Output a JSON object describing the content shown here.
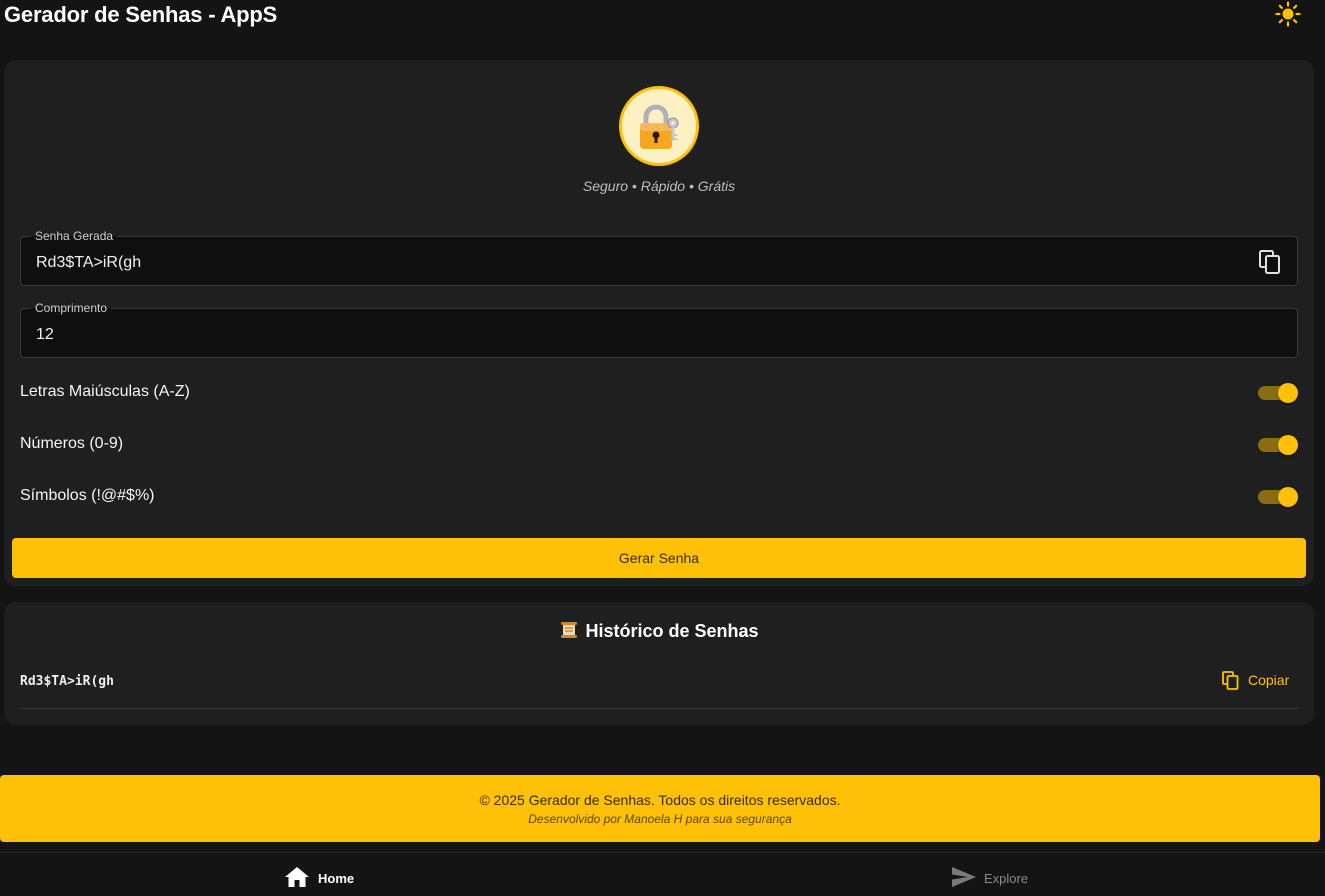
{
  "header": {
    "title": "Gerador de Senhas - AppS",
    "theme_icon": "sun-icon"
  },
  "generator": {
    "logo_icon": "lock-with-key-icon",
    "tagline": "Seguro • Rápido • Grátis",
    "password_field": {
      "label": "Senha Gerada",
      "value": "Rd3$TA>iR(gh",
      "copy_icon": "copy-icon"
    },
    "length_field": {
      "label": "Comprimento",
      "value": "12"
    },
    "options": [
      {
        "label": "Letras Maiúsculas (A-Z)",
        "enabled": true
      },
      {
        "label": "Números (0-9)",
        "enabled": true
      },
      {
        "label": "Símbolos (!@#$%)",
        "enabled": true
      }
    ],
    "generate_button": "Gerar Senha"
  },
  "history": {
    "icon": "scroll-icon",
    "title": "Histórico de Senhas",
    "items": [
      {
        "password": "Rd3$TA>iR(gh",
        "copy_label": "Copiar"
      }
    ]
  },
  "footer": {
    "copyright": "© 2025 Gerador de Senhas. Todos os direitos reservados.",
    "credit": "Desenvolvido por Manoela H para sua segurança"
  },
  "bottom_nav": {
    "items": [
      {
        "label": "Home",
        "icon": "home-icon",
        "active": true
      },
      {
        "label": "Explore",
        "icon": "send-icon",
        "active": false
      }
    ]
  },
  "colors": {
    "background": "#141414",
    "card": "#1f1f1f",
    "accent": "#ffc107"
  }
}
